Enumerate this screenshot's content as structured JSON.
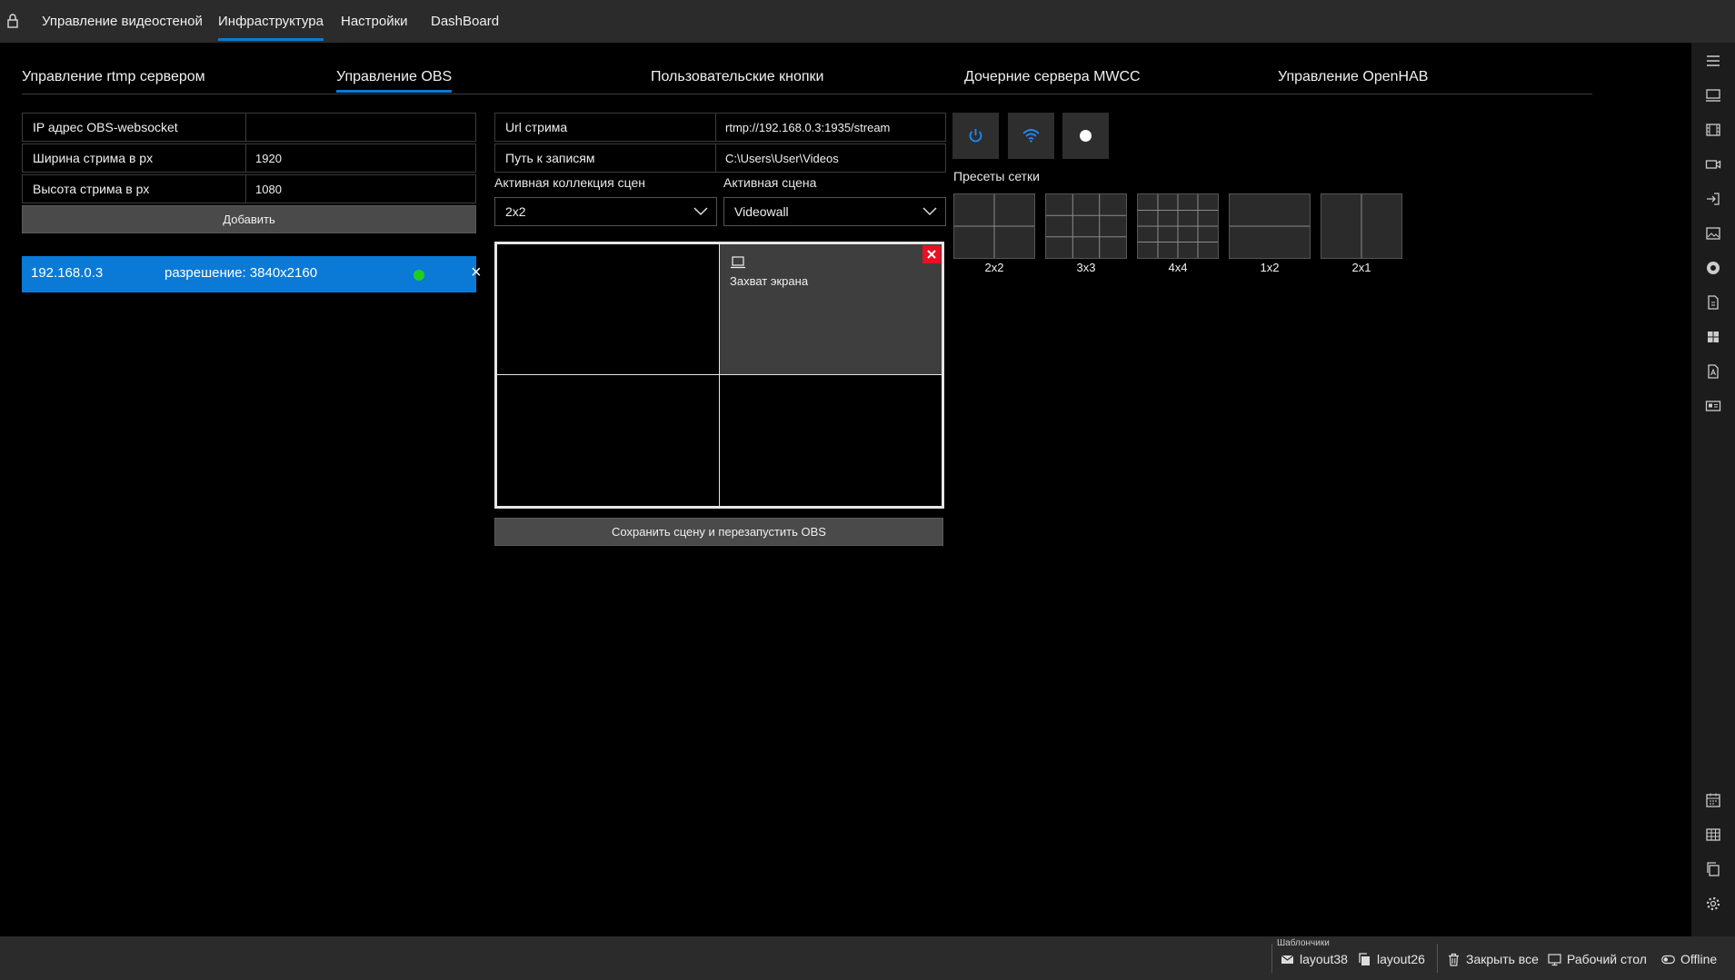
{
  "topnav": {
    "items": [
      {
        "label": "Управление видеостеной"
      },
      {
        "label": "Инфраструктура"
      },
      {
        "label": "Настройки"
      },
      {
        "label": "DashBoard"
      }
    ]
  },
  "subtabs": [
    {
      "label": "Управление rtmp сервером"
    },
    {
      "label": "Управление OBS"
    },
    {
      "label": "Пользовательские кнопки"
    },
    {
      "label": "Дочерние сервера MWCC"
    },
    {
      "label": "Управление OpenHAB"
    }
  ],
  "obs_form": {
    "ip_label": "IP адрес OBS-websocket",
    "ip_value": "",
    "width_label": "Ширина стрима в px",
    "width_value": "1920",
    "height_label": "Высота стрима в px",
    "height_value": "1080",
    "add_button": "Добавить"
  },
  "server": {
    "ip": "192.168.0.3",
    "resolution": "разрешение: 3840x2160",
    "status_color": "#1ed01e",
    "remove_label": "×"
  },
  "stream": {
    "url_label": "Url стрима",
    "url_value": "rtmp://192.168.0.3:1935/stream",
    "path_label": "Путь к записям",
    "path_value": "C:\\Users\\User\\Videos",
    "collection_label": "Активная коллекция сцен",
    "collection_value": "2x2",
    "scene_label": "Активная сцена",
    "scene_value": "Videowall"
  },
  "scene_grid": {
    "layout": "2x2",
    "cells": [
      {
        "source": ""
      },
      {
        "source": "Захват экрана",
        "icon": "laptop-icon"
      },
      {
        "source": ""
      },
      {
        "source": ""
      }
    ],
    "save_button": "Сохранить сцену и перезапустить OBS"
  },
  "control_buttons": [
    {
      "icon": "power-icon"
    },
    {
      "icon": "wifi-icon"
    },
    {
      "icon": "record-icon"
    }
  ],
  "presets": {
    "title": "Пресеты сетки",
    "items": [
      {
        "label": "2x2",
        "rows": 2,
        "cols": 2
      },
      {
        "label": "3x3",
        "rows": 3,
        "cols": 3
      },
      {
        "label": "4x4",
        "rows": 4,
        "cols": 4
      },
      {
        "label": "1x2",
        "rows": 2,
        "cols": 1
      },
      {
        "label": "2x1",
        "rows": 1,
        "cols": 2
      }
    ]
  },
  "sidebar_icons": [
    "menu-icon",
    "monitor-icon",
    "film-icon",
    "video-camera-icon",
    "login-icon",
    "image-icon",
    "chrome-icon",
    "pdf-file-icon",
    "windows-icon",
    "acrobat-file-icon",
    "id-card-icon",
    "calendar-icon",
    "table-icon",
    "copy-icon",
    "settings-icon"
  ],
  "bottombar": {
    "templates_label": "Шаблончики",
    "template1": "layout38",
    "template2": "layout26",
    "close_all": "Закрыть все",
    "desktop": "Рабочий стол",
    "status": "Offline"
  },
  "colors": {
    "accent": "#0a7ad6",
    "close_red": "#e81123"
  }
}
